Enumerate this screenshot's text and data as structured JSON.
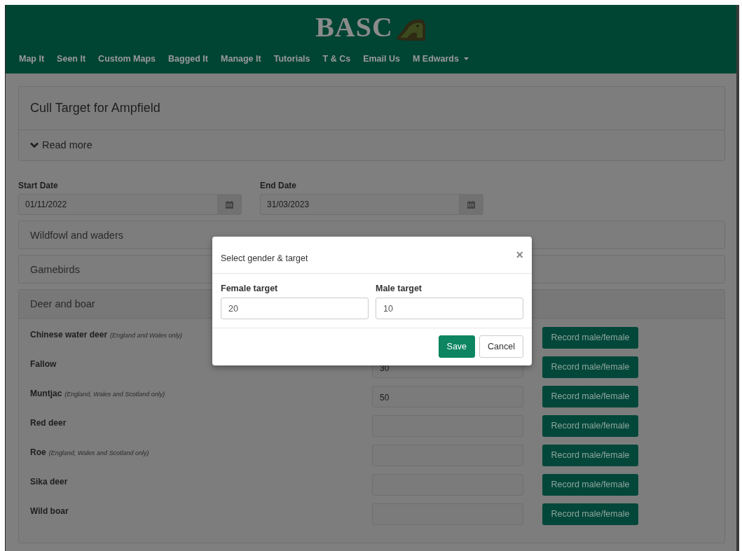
{
  "header": {
    "logo": "BASC"
  },
  "nav": [
    {
      "label": "Map It",
      "kind": "link"
    },
    {
      "label": "Seen It",
      "kind": "link"
    },
    {
      "label": "Custom Maps",
      "kind": "link"
    },
    {
      "label": "Bagged It",
      "kind": "link"
    },
    {
      "label": "Manage It",
      "kind": "link"
    },
    {
      "label": "Tutorials",
      "kind": "link"
    },
    {
      "label": "T & Cs",
      "kind": "link"
    },
    {
      "label": "Email Us",
      "kind": "link"
    },
    {
      "label": "M Edwards",
      "kind": "dropdown"
    }
  ],
  "intro": {
    "title": "Cull Target for Ampfield",
    "toggle": "Read more"
  },
  "dates": [
    {
      "label": "Start Date",
      "value": "01/11/2022"
    },
    {
      "label": "End Date",
      "value": "31/03/2023"
    }
  ],
  "sections": [
    {
      "title": "Wildfowl and waders",
      "expanded": false
    },
    {
      "title": "Gamebirds",
      "expanded": false
    },
    {
      "title": "Deer and boar",
      "expanded": true
    }
  ],
  "species": [
    {
      "name": "Chinese water deer",
      "note": "(England and Wales only)",
      "button": "Record male/female"
    },
    {
      "name": "Fallow",
      "value": "30",
      "button": "Record male/female"
    },
    {
      "name": "Muntjac",
      "note": "(England, Wales and Scotland only)",
      "value": "50",
      "button": "Record male/female"
    },
    {
      "name": "Red deer",
      "button": "Record male/female"
    },
    {
      "name": "Roe",
      "note": "(England, Wales and Scotland only)",
      "button": "Record male/female"
    },
    {
      "name": "Sika deer",
      "button": "Record male/female"
    },
    {
      "name": "Wild boar",
      "button": "Record male/female"
    }
  ],
  "modal": {
    "title": "Select gender & target",
    "close": "×",
    "fields": [
      {
        "label": "Female target",
        "value": "20"
      },
      {
        "label": "Male target",
        "value": "10"
      }
    ],
    "buttons": [
      {
        "label": "Save",
        "kind": "primary"
      },
      {
        "label": "Cancel",
        "kind": "default"
      }
    ]
  }
}
